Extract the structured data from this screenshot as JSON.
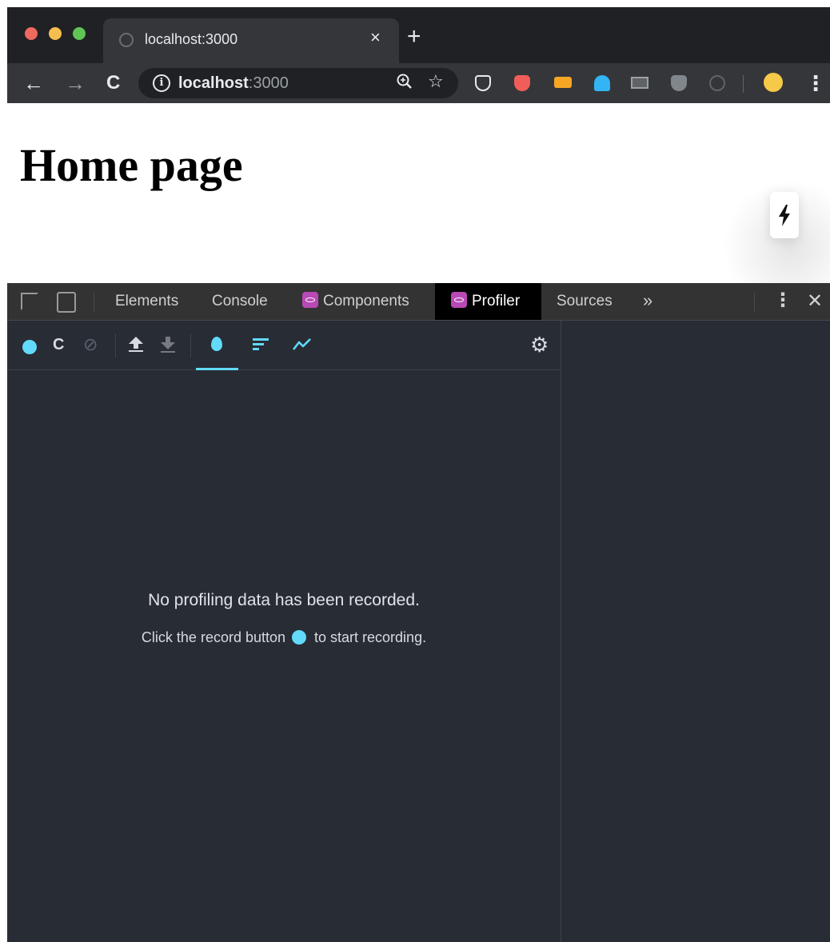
{
  "browser": {
    "tab": {
      "title": "localhost:3000",
      "close": "×"
    },
    "new_tab": "+",
    "nav": {
      "back": "←",
      "forward": "→",
      "reload": "C"
    },
    "omnibox": {
      "info": "i",
      "host": "localhost",
      "port": ":3000"
    },
    "menu": "⋮"
  },
  "page": {
    "heading": "Home page"
  },
  "devtools": {
    "tabs": [
      {
        "label": "Elements"
      },
      {
        "label": "Console"
      },
      {
        "label": "Components"
      },
      {
        "label": "Profiler"
      },
      {
        "label": "Sources"
      }
    ],
    "active_tab": "Profiler",
    "more": "»",
    "kebab": "⋮",
    "close": "✕"
  },
  "profiler": {
    "empty_title": "No profiling data has been recorded.",
    "hint_before": "Click the record button",
    "hint_after": "to start recording.",
    "reload_icon": "C",
    "clear_icon": "⊘",
    "settings_icon": "⚙"
  },
  "colors": {
    "react_blue": "#61dafb",
    "react_badge": "#b949b5",
    "devtools_bg": "#282c34"
  }
}
